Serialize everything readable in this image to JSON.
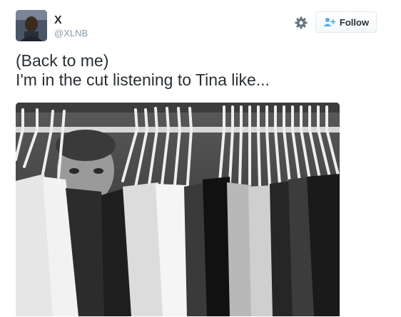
{
  "user": {
    "display_name": "X",
    "handle": "@XLNB"
  },
  "actions": {
    "follow_label": "Follow",
    "settings_icon": "gear-icon",
    "follow_icon": "add-user-icon",
    "accent_color": "#55acee"
  },
  "tweet": {
    "lines": [
      "(Back to me)",
      "I'm in the cut listening to Tina like..."
    ]
  },
  "media": {
    "photo_alt": ""
  }
}
